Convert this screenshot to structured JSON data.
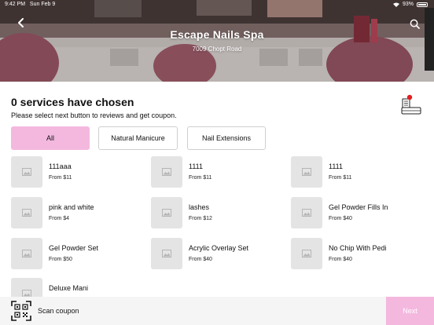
{
  "status_bar": {
    "time": "9:42 PM",
    "date": "Sun Feb 9",
    "battery": "93%"
  },
  "header": {
    "title": "Escape Nails Spa",
    "address": "7009 Chopt Road",
    "back_icon": "chevron-left-icon",
    "search_icon": "search-icon"
  },
  "summary": {
    "title": "0 services have chosen",
    "subtitle": "Please select next button to reviews and get coupon."
  },
  "categories": [
    {
      "label": "All",
      "selected": true
    },
    {
      "label": "Natural Manicure",
      "selected": false
    },
    {
      "label": "Nail Extensions",
      "selected": false
    }
  ],
  "services": [
    {
      "name": "111aaa",
      "price": "From $11"
    },
    {
      "name": "1111",
      "price": "From $11"
    },
    {
      "name": "1111",
      "price": "From $11"
    },
    {
      "name": "pink and white",
      "price": "From $4"
    },
    {
      "name": "lashes",
      "price": "From $12"
    },
    {
      "name": "Gel Powder Fills In",
      "price": "From $40"
    },
    {
      "name": "Gel Powder Set",
      "price": "From $50"
    },
    {
      "name": "Acrylic Overlay Set",
      "price": "From $40"
    },
    {
      "name": "No Chip With Pedi",
      "price": "From $40"
    },
    {
      "name": "Deluxe Mani",
      "price": ""
    }
  ],
  "footer": {
    "scan_label": "Scan coupon",
    "next_label": "Next"
  },
  "colors": {
    "accent": "#f4b8df",
    "placeholder": "#e4e4e4",
    "cart_badge": "#e02020"
  }
}
